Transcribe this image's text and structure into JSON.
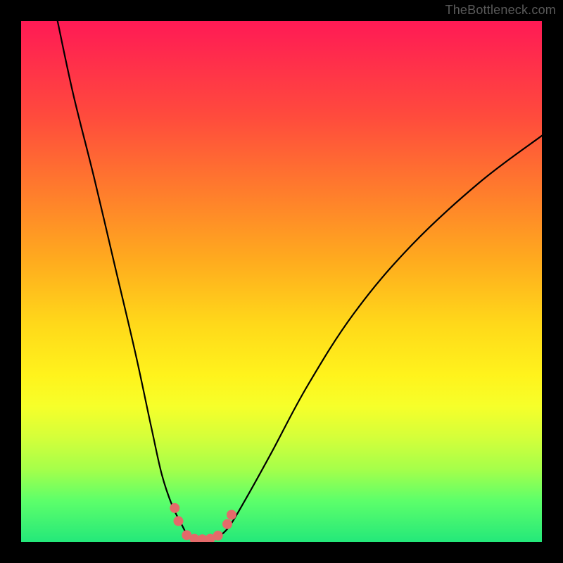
{
  "attribution": "TheBottleneck.com",
  "colors": {
    "frame_background": "#000000",
    "curve_stroke": "#000000",
    "marker_fill": "#e46a6a",
    "attribution_text": "#5a5a5a",
    "gradient_stops": [
      "#ff1a55",
      "#ff2a4d",
      "#ff4a3d",
      "#ff7a2d",
      "#ffab1e",
      "#ffd81a",
      "#fff31c",
      "#f6ff2a",
      "#d4ff3a",
      "#a6ff4a",
      "#5eff6a",
      "#24e87a"
    ]
  },
  "chart_data": {
    "type": "line",
    "title": "",
    "xlabel": "",
    "ylabel": "",
    "xlim": [
      0,
      100
    ],
    "ylim": [
      0,
      100
    ],
    "note": "Displayed as a V-shaped bottleneck curve over a vertical red→green gradient. X appears to represent a hardware pairing axis; Y represents bottleneck severity (higher = worse, red). No axis ticks or labels are shown. Values below are estimated from pixel positions on a 0–100 normalized grid.",
    "series": [
      {
        "name": "bottleneck-curve-left",
        "x": [
          7,
          10,
          14,
          18,
          22,
          25,
          27,
          29,
          31,
          32
        ],
        "y": [
          100,
          86,
          70,
          53,
          36,
          22,
          13,
          7,
          3,
          1
        ]
      },
      {
        "name": "bottleneck-curve-floor",
        "x": [
          32,
          33.5,
          35,
          36.5,
          38
        ],
        "y": [
          1,
          0.5,
          0.5,
          0.5,
          1
        ]
      },
      {
        "name": "bottleneck-curve-right",
        "x": [
          38,
          40,
          43,
          48,
          55,
          64,
          75,
          88,
          100
        ],
        "y": [
          1,
          3,
          8,
          17,
          30,
          44,
          57,
          69,
          78
        ]
      }
    ],
    "markers": {
      "name": "highlight-points",
      "points": [
        {
          "x": 29.5,
          "y": 6.5
        },
        {
          "x": 30.2,
          "y": 4.0
        },
        {
          "x": 31.8,
          "y": 1.3
        },
        {
          "x": 33.3,
          "y": 0.6
        },
        {
          "x": 34.8,
          "y": 0.5
        },
        {
          "x": 36.3,
          "y": 0.6
        },
        {
          "x": 37.8,
          "y": 1.2
        },
        {
          "x": 39.6,
          "y": 3.4
        },
        {
          "x": 40.4,
          "y": 5.2
        }
      ],
      "radius_px": 7
    }
  }
}
